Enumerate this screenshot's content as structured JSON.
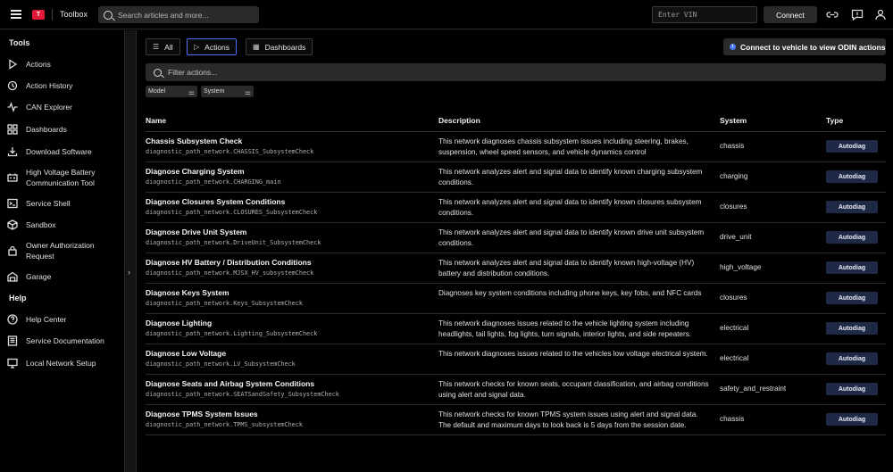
{
  "header": {
    "app_title": "Toolbox",
    "logo_text": "T",
    "search_placeholder": "Search articles and more...",
    "vin_placeholder": "Enter VIN",
    "connect_label": "Connect"
  },
  "sidebar": {
    "tools_title": "Tools",
    "help_title": "Help",
    "tools": [
      {
        "label": "Actions",
        "icon": "play-icon"
      },
      {
        "label": "Action History",
        "icon": "history-icon"
      },
      {
        "label": "CAN Explorer",
        "icon": "waveform-icon"
      },
      {
        "label": "Dashboards",
        "icon": "grid-icon"
      },
      {
        "label": "Download Software",
        "icon": "download-icon"
      },
      {
        "label": "High Voltage Battery Communication Tool",
        "icon": "battery-icon"
      },
      {
        "label": "Service Shell",
        "icon": "terminal-icon"
      },
      {
        "label": "Sandbox",
        "icon": "box-icon"
      },
      {
        "label": "Owner Authorization Request",
        "icon": "lock-icon"
      },
      {
        "label": "Garage",
        "icon": "garage-icon"
      }
    ],
    "help": [
      {
        "label": "Help Center",
        "icon": "question-icon"
      },
      {
        "label": "Service Documentation",
        "icon": "document-icon"
      },
      {
        "label": "Local Network Setup",
        "icon": "monitor-icon"
      }
    ]
  },
  "main": {
    "tabs": [
      {
        "label": "All"
      },
      {
        "label": "Actions"
      },
      {
        "label": "Dashboards"
      }
    ],
    "odin_banner": "Connect to vehicle to view ODIN actions",
    "filter_placeholder": "Filter actions...",
    "chips": [
      {
        "label": "Model"
      },
      {
        "label": "System"
      }
    ],
    "columns": [
      "Name",
      "Description",
      "System",
      "Type"
    ],
    "rows": [
      {
        "title": "Chassis Subsystem Check",
        "path": "diagnostic_path_network.CHASSIS_SubsystemCheck",
        "desc": "This network diagnoses chassis subsystem issues including steering, brakes, suspension, wheel speed sensors, and vehicle dynamics control",
        "system": "chassis",
        "type": "Autodiag"
      },
      {
        "title": "Diagnose Charging System",
        "path": "diagnostic_path_network.CHARGING_main",
        "desc": "This network analyzes alert and signal data to identify known charging subsystem conditions.",
        "system": "charging",
        "type": "Autodiag"
      },
      {
        "title": "Diagnose Closures System Conditions",
        "path": "diagnostic_path_network.CLOSURES_SubsystemCheck",
        "desc": "This network analyzes alert and signal data to identify known closures subsystem conditions.",
        "system": "closures",
        "type": "Autodiag"
      },
      {
        "title": "Diagnose Drive Unit System",
        "path": "diagnostic_path_network.DriveUnit_SubsystemCheck",
        "desc": "This network analyzes alert and signal data to identify known drive unit subsystem conditions.",
        "system": "drive_unit",
        "type": "Autodiag"
      },
      {
        "title": "Diagnose HV Battery / Distribution Conditions",
        "path": "diagnostic_path_network.MJSX_HV_subsystemCheck",
        "desc": "This network analyzes alert and signal data to identify known high-voltage (HV) battery and distribution conditions.",
        "system": "high_voltage",
        "type": "Autodiag"
      },
      {
        "title": "Diagnose Keys System",
        "path": "diagnostic_path_network.Keys_SubsystemCheck",
        "desc": "Diagnoses key system conditions including phone keys, key fobs, and NFC cards",
        "system": "closures",
        "type": "Autodiag"
      },
      {
        "title": "Diagnose Lighting",
        "path": "diagnostic_path_network.Lighting_SubsystemCheck",
        "desc": "This network diagnoses issues related to the vehicle lighting system including headlights, tail lights, fog lights, turn signals, interior lights, and side repeaters.",
        "system": "electrical",
        "type": "Autodiag"
      },
      {
        "title": "Diagnose Low Voltage",
        "path": "diagnostic_path_network.LV_SubsystemCheck",
        "desc": "This network diagnoses issues related to the vehicles low voltage electrical system.",
        "system": "electrical",
        "type": "Autodiag"
      },
      {
        "title": "Diagnose Seats and Airbag System Conditions",
        "path": "diagnostic_path_network.SEATSandSafety_SubsystemCheck",
        "desc": "This network checks for known seats, occupant classification, and airbag conditions using alert and signal data.",
        "system": "safety_and_restraint",
        "type": "Autodiag"
      },
      {
        "title": "Diagnose TPMS System Issues",
        "path": "diagnostic_path_network.TPMS_subsystemCheck",
        "desc": "This network checks for known TPMS system issues using alert and signal data. The default and maximum days to look back is 5 days from the session date.",
        "system": "chassis",
        "type": "Autodiag"
      }
    ]
  }
}
